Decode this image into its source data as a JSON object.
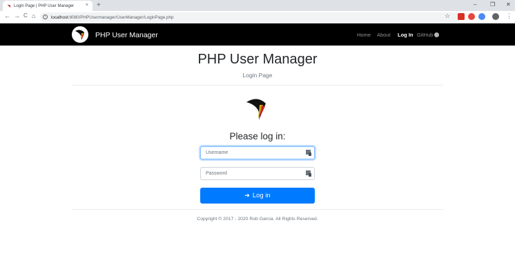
{
  "browser": {
    "tab_title": "Login Page | PHP User Manager",
    "tab_close": "×",
    "new_tab": "+",
    "url_host": "localhost",
    "url_rest": ":8080/PHPUsermanager/UserManager/LoginPage.php",
    "window_controls": [
      "–",
      "❐",
      "✕"
    ],
    "nav": {
      "back": "←",
      "forward": "→",
      "reload": "C",
      "home": "⌂"
    },
    "star": "☆",
    "menu": "⋮"
  },
  "navbar": {
    "brand": "PHP User Manager",
    "links": [
      {
        "label": "Home"
      },
      {
        "label": "About"
      },
      {
        "label": "Log In"
      },
      {
        "label": "GitHub"
      }
    ]
  },
  "header": {
    "title": "PHP User Manager",
    "subtitle": "Login Page"
  },
  "form": {
    "heading": "Please log in:",
    "username_placeholder": "Username",
    "password_placeholder": "Password",
    "button_label": "Log in"
  },
  "footer": {
    "copyright": "Copyright © 2017 - 2020 Rob Garcia. All Rights Reserved."
  },
  "colors": {
    "navbar_bg": "#000000",
    "primary": "#007bff"
  }
}
